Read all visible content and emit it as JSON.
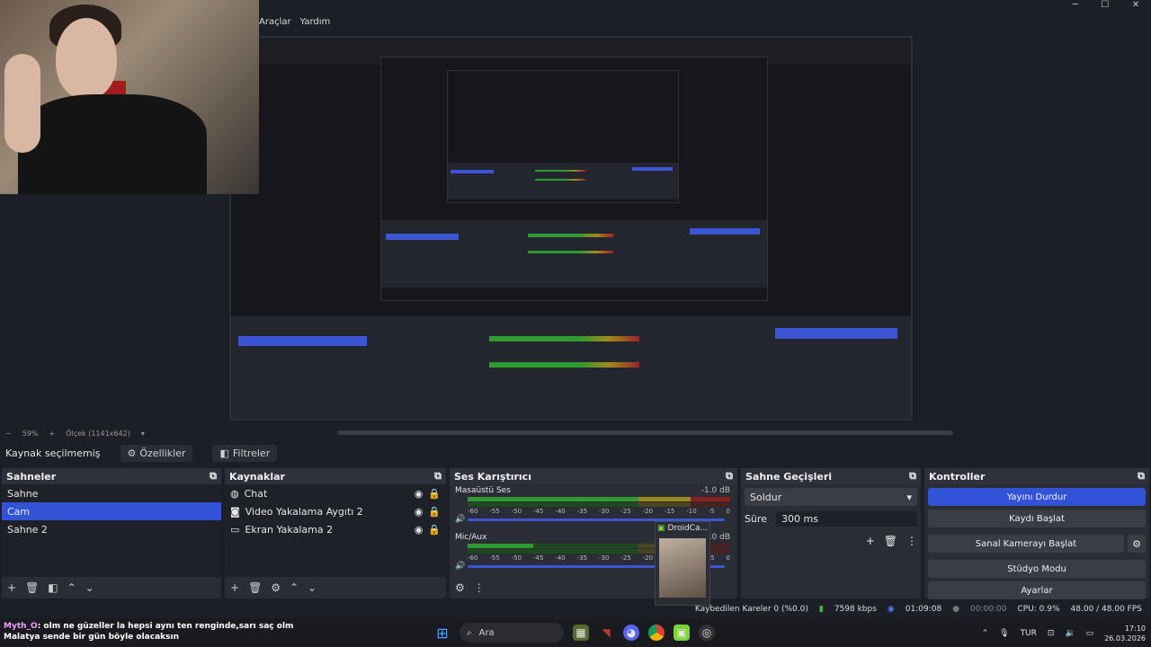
{
  "menu": {
    "items": [
      "Araçlar",
      "Yardım"
    ]
  },
  "window_controls": {
    "minimize": "─",
    "maximize": "☐",
    "close": "✕"
  },
  "preview_status": {
    "zoom": "59%",
    "scale": "Ölçek (1141x642)"
  },
  "source_bar": {
    "no_source": "Kaynak seçilmemiş",
    "properties": "Özellikler",
    "filters": "Filtreler"
  },
  "scenes": {
    "title": "Sahneler",
    "items": [
      {
        "label": "Sahne",
        "selected": false
      },
      {
        "label": "Cam",
        "selected": true
      },
      {
        "label": "Sahne 2",
        "selected": false
      }
    ]
  },
  "sources": {
    "title": "Kaynaklar",
    "items": [
      {
        "label": "Chat",
        "icon": "browser-icon"
      },
      {
        "label": "Video Yakalama Aygıtı 2",
        "icon": "camera-icon"
      },
      {
        "label": "Ekran Yakalama 2",
        "icon": "monitor-icon"
      }
    ]
  },
  "mixer": {
    "title": "Ses Karıştırıcı",
    "channels": [
      {
        "name": "Masaüstü Ses",
        "db": "-1.0 dB"
      },
      {
        "name": "Mic/Aux",
        "db": "0.0 dB"
      }
    ],
    "ticks": [
      "-60",
      "-55",
      "-50",
      "-45",
      "-40",
      "-35",
      "-30",
      "-25",
      "-20",
      "-15",
      "-10",
      "-5",
      "0"
    ]
  },
  "transitions": {
    "title": "Sahne Geçişleri",
    "selected": "Soldur",
    "duration_label": "Süre",
    "duration_value": "300 ms"
  },
  "controls": {
    "title": "Kontroller",
    "stop_stream": "Yayını Durdur",
    "start_record": "Kaydı Başlat",
    "start_vcam": "Sanal Kamerayı Başlat",
    "studio_mode": "Stüdyo Modu",
    "settings": "Ayarlar"
  },
  "droidcam": {
    "label": "DroidCa..."
  },
  "status": {
    "dropped": "Kaybedilen Kareler 0 (%0.0)",
    "bitrate": "7598 kbps",
    "stream_time": "01:09:08",
    "rec_time": "00:00:00",
    "cpu": "CPU: 0.9%",
    "fps": "48.00 / 48.00 FPS"
  },
  "chat": {
    "user": "Myth_O",
    "message": ": olm ne güzeller la hepsi aynı ten renginde,sarı saç olm Malatya sende bir gün böyle olacaksın"
  },
  "taskbar": {
    "search": "Ara",
    "lang": "TUR",
    "time": "17:10",
    "date": "26.03.2026"
  },
  "colors": {
    "accent": "#3353d6",
    "panel": "#2a2d36",
    "bg": "#1d1f26"
  }
}
